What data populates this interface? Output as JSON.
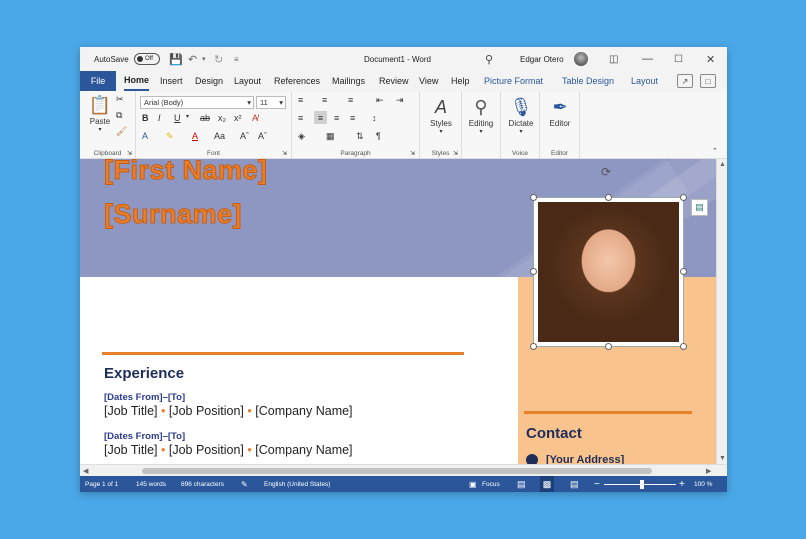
{
  "titlebar": {
    "autosave_label": "AutoSave",
    "autosave_state": "Off",
    "doc_title": "Document1 - Word",
    "user_name": "Edgar Otero"
  },
  "tabs": [
    "File",
    "Home",
    "Insert",
    "Design",
    "Layout",
    "References",
    "Mailings",
    "Review",
    "View",
    "Help",
    "Picture Format",
    "Table Design",
    "Layout"
  ],
  "ribbon": {
    "clipboard": {
      "paste_label": "Paste",
      "group_label": "Clipboard"
    },
    "font": {
      "font_name": "Arial (Body)",
      "font_size": "11",
      "group_label": "Font"
    },
    "paragraph": {
      "group_label": "Paragraph"
    },
    "styles": {
      "styles_label": "Styles",
      "group_label": "Styles"
    },
    "editing": {
      "editing_label": "Editing"
    },
    "voice": {
      "dictate_label": "Dictate",
      "group_label": "Voice"
    },
    "editor": {
      "editor_label": "Editor",
      "group_label": "Editor"
    }
  },
  "document": {
    "first_name": "[First Name]",
    "surname": "[Surname]",
    "experience_title": "Experience",
    "entries": [
      {
        "dates": "[Dates From]–[To]",
        "job_title": "[Job Title]",
        "job_position": "[Job Position]",
        "company": "[Company Name]"
      },
      {
        "dates": "[Dates From]–[To]",
        "job_title": "[Job Title]",
        "job_position": "[Job Position]",
        "company": "[Company Name]"
      }
    ],
    "separator": "•",
    "contact_title": "Contact",
    "address": "[Your Address]"
  },
  "statusbar": {
    "page": "Page 1 of 1",
    "words": "145 words",
    "characters": "896 characters",
    "language": "English (United States)",
    "focus": "Focus",
    "zoom": "100 %"
  },
  "colors": {
    "word_blue": "#2b579a",
    "banner": "#8e96c2",
    "accent_orange": "#e8822a",
    "sidebar_peach": "#f9c38e",
    "heading_navy": "#1f2d5a"
  }
}
